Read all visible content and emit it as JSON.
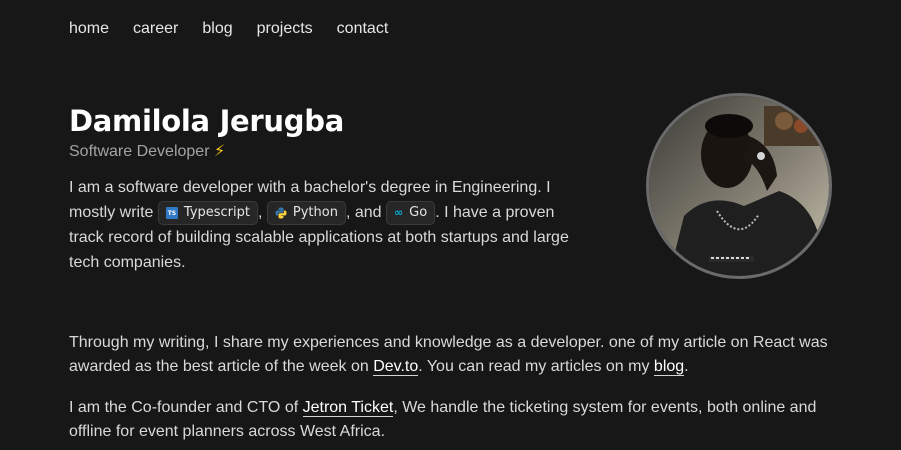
{
  "nav": [
    {
      "label": "home"
    },
    {
      "label": "career"
    },
    {
      "label": "blog"
    },
    {
      "label": "projects"
    },
    {
      "label": "contact"
    }
  ],
  "header": {
    "name": "Damilola Jerugba",
    "subtitle": "Software Developer",
    "subtitle_emoji": "⚡"
  },
  "intro": {
    "text1": "I am a software developer with a bachelor's degree in Engineering. I mostly write ",
    "chip_typescript": "Typescript",
    "sep1": ", ",
    "chip_python": "Python",
    "sep2": ", and ",
    "chip_go": "Go",
    "text2": ". I have a proven track record of building scalable applications at both startups and large tech companies."
  },
  "writing": {
    "text1": "Through my writing, I share my experiences and knowledge as a developer. one of my article on React was awarded as the best article of the week on ",
    "link_devto": "Dev.to",
    "text2": ". You can read my articles on my ",
    "link_blog": "blog",
    "text3": "."
  },
  "cofounder": {
    "text1": "I am the Co-founder and CTO of ",
    "link_jetron": "Jetron Ticket",
    "text2": ", We handle the ticketing system for events, both online and offline for event planners across West Africa."
  },
  "icons": {
    "typescript": "typescript-icon",
    "python": "python-icon",
    "go": "go-icon"
  },
  "colors": {
    "background": "#171717",
    "accent_bolt": "#f5c518",
    "typescript": "#3178c6",
    "go": "#00add8"
  }
}
